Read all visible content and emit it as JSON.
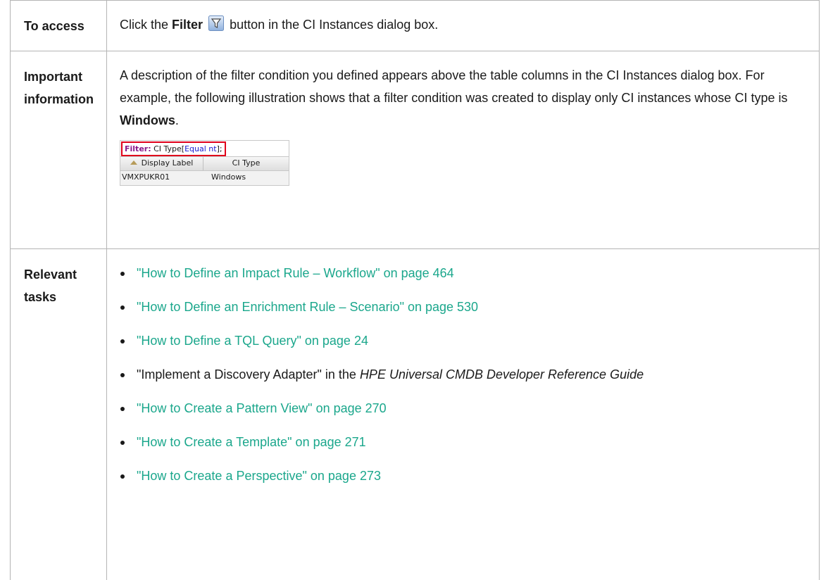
{
  "access": {
    "label": "To access",
    "text_before": "Click the ",
    "bold": "Filter",
    "text_after": " button in the CI Instances dialog box.",
    "icon": "filter-icon"
  },
  "info": {
    "label_line1": "Important",
    "label_line2": "information",
    "text": "A description of the filter condition you defined appears above the table columns in the CI Instances dialog box. For example, the following illustration shows that a filter condition was created to display only CI instances whose CI type is ",
    "bold": "Windows",
    "text_end": ".",
    "screenshot": {
      "filter_key": "Filter:",
      "filter_prefix": " CI Type[",
      "filter_cond": "Equal nt",
      "filter_suffix": "];",
      "col1": "Display Label",
      "col2": "CI Type",
      "row_c1": "VMXPUKR01",
      "row_c2": "Windows"
    }
  },
  "tasks": {
    "label_line1": "Relevant",
    "label_line2": "tasks",
    "items": [
      "\"How to Define an Impact Rule – Workflow\" on page 464",
      "\"How to Define an Enrichment Rule – Scenario\" on page 530",
      "\"How to Define a TQL Query\" on page 24",
      "\"How to Create a Pattern View\" on page 270",
      "\"How to Create a Template\" on page 271",
      "\"How to Create a Perspective\" on page 273"
    ],
    "plain_item": {
      "text": "\"Implement a Discovery Adapter\" in the ",
      "italic": "HPE Universal CMDB Developer Reference Guide"
    }
  },
  "colors": {
    "link": "#1ba78c",
    "border": "#b4b4b4",
    "highlight": "#e0001b"
  }
}
